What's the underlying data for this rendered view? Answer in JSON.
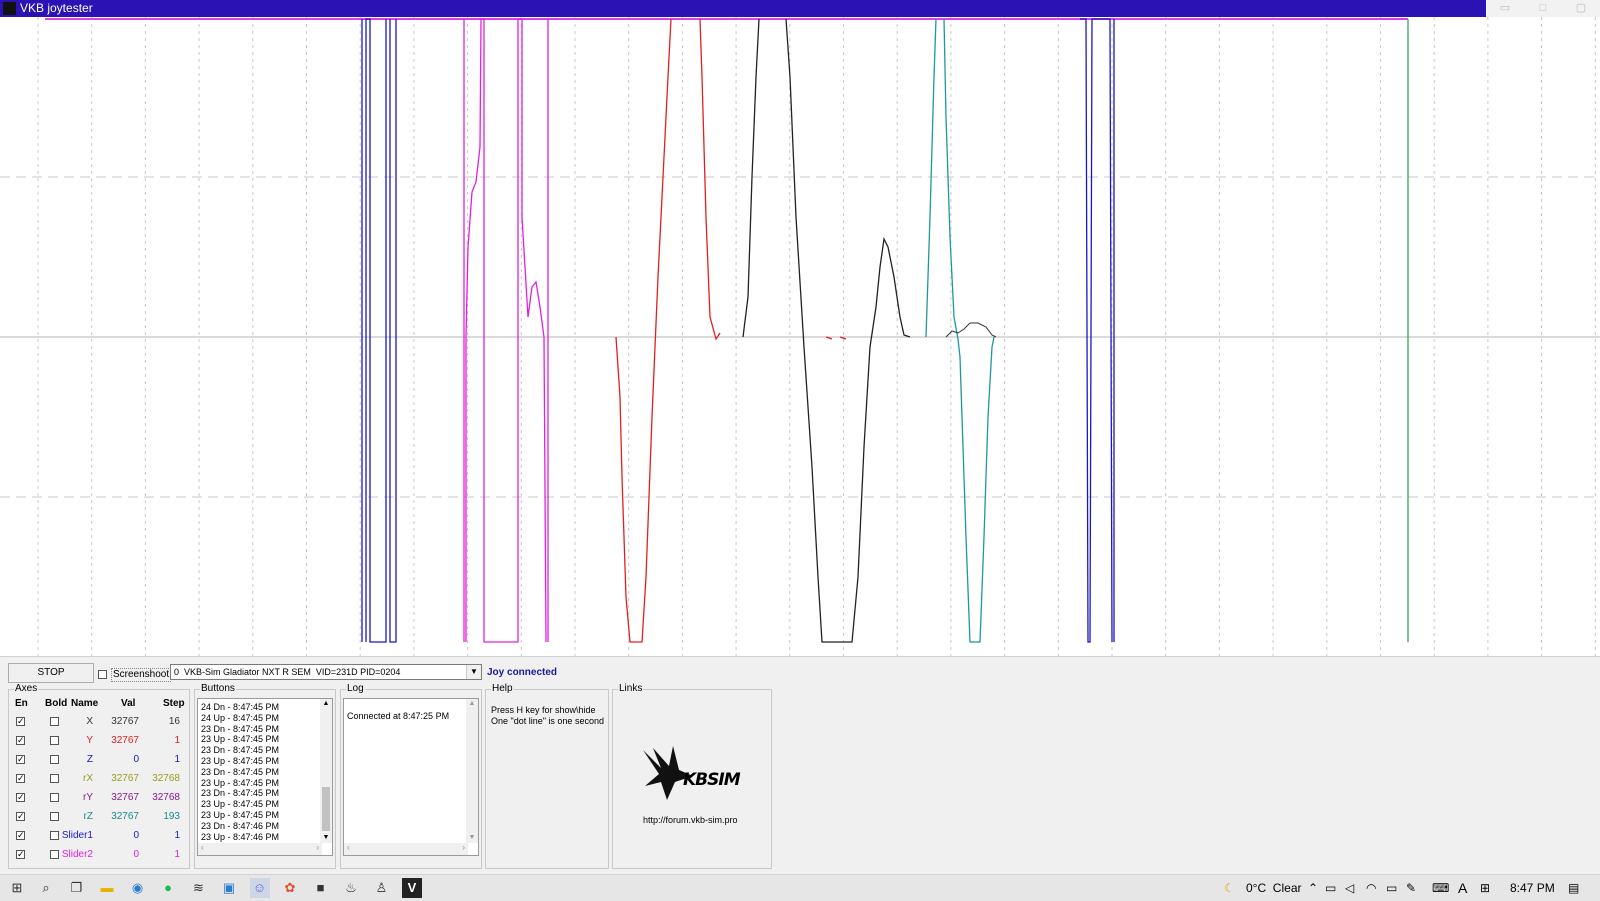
{
  "window": {
    "title": "VKB joytester",
    "controls": {
      "minimize": "▭",
      "maximize": "□",
      "close": "▢"
    }
  },
  "graph": {
    "background": "#ffffff",
    "grid_color": "#c8c8c8",
    "center_line_color": "#b4b4b4",
    "cursor_color": "#3aa65a"
  },
  "toolbar": {
    "stop_label": "STOP",
    "screenshot_label": "Screenshoot",
    "screenshot_checked": false,
    "device_selected": "0  VKB-Sim Gladiator NXT R SEM  VID=231D PID=0204",
    "status": "Joy connected",
    "status_color": "#1a1a9a"
  },
  "axes": {
    "legend": "Axes",
    "headers": {
      "en": "En",
      "bold": "Bold",
      "name": "Name",
      "val": "Val",
      "step": "Step"
    },
    "rows": [
      {
        "name": "X",
        "val": "32767",
        "step": "16",
        "color": "#333333",
        "en": true,
        "bold": false
      },
      {
        "name": "Y",
        "val": "32767",
        "step": "1",
        "color": "#e02020",
        "en": true,
        "bold": false
      },
      {
        "name": "Z",
        "val": "0",
        "step": "1",
        "color": "#1818b0",
        "en": true,
        "bold": false
      },
      {
        "name": "rX",
        "val": "32767",
        "step": "32768",
        "color": "#9a9a20",
        "en": true,
        "bold": false
      },
      {
        "name": "rY",
        "val": "32767",
        "step": "32768",
        "color": "#8a1a8a",
        "en": true,
        "bold": false
      },
      {
        "name": "rZ",
        "val": "32767",
        "step": "193",
        "color": "#1a8a8a",
        "en": true,
        "bold": false
      },
      {
        "name": "Slider1",
        "val": "0",
        "step": "1",
        "color": "#1818d0",
        "en": true,
        "bold": false
      },
      {
        "name": "Slider2",
        "val": "0",
        "step": "1",
        "color": "#e020e0",
        "en": true,
        "bold": false
      }
    ]
  },
  "buttons_log": {
    "legend": "Buttons",
    "entries": [
      "24 Dn - 8:47:45 PM",
      "24 Up - 8:47:45 PM",
      "23 Dn - 8:47:45 PM",
      "23 Up - 8:47:45 PM",
      "23 Dn - 8:47:45 PM",
      "23 Up - 8:47:45 PM",
      "23 Dn - 8:47:45 PM",
      "23 Up - 8:47:45 PM",
      "23 Dn - 8:47:45 PM",
      "23 Up - 8:47:45 PM",
      "23 Up - 8:47:45 PM",
      "23 Dn - 8:47:46 PM",
      "23 Up - 8:47:46 PM"
    ]
  },
  "log": {
    "legend": "Log",
    "entries": [
      "Connected at 8:47:25 PM"
    ]
  },
  "help": {
    "legend": "Help",
    "lines": [
      "Press H key for show\\hide",
      "One \"dot line\" is one second"
    ]
  },
  "links": {
    "legend": "Links",
    "logo_text": "KBSIM",
    "url": "http://forum.vkb-sim.pro"
  },
  "taskbar": {
    "apps": [
      "start-icon",
      "search-icon",
      "task-view-icon",
      "file-explorer-icon",
      "browser-icon",
      "spotify-icon",
      "network-app-icon",
      "remote-desktop-icon",
      "discord-icon",
      "paint-icon",
      "media-icon",
      "steam-icon",
      "joystick-app-icon",
      "vkb-joytester-icon"
    ],
    "weather": "0°C  Clear",
    "clock": "8:47 PM"
  }
}
